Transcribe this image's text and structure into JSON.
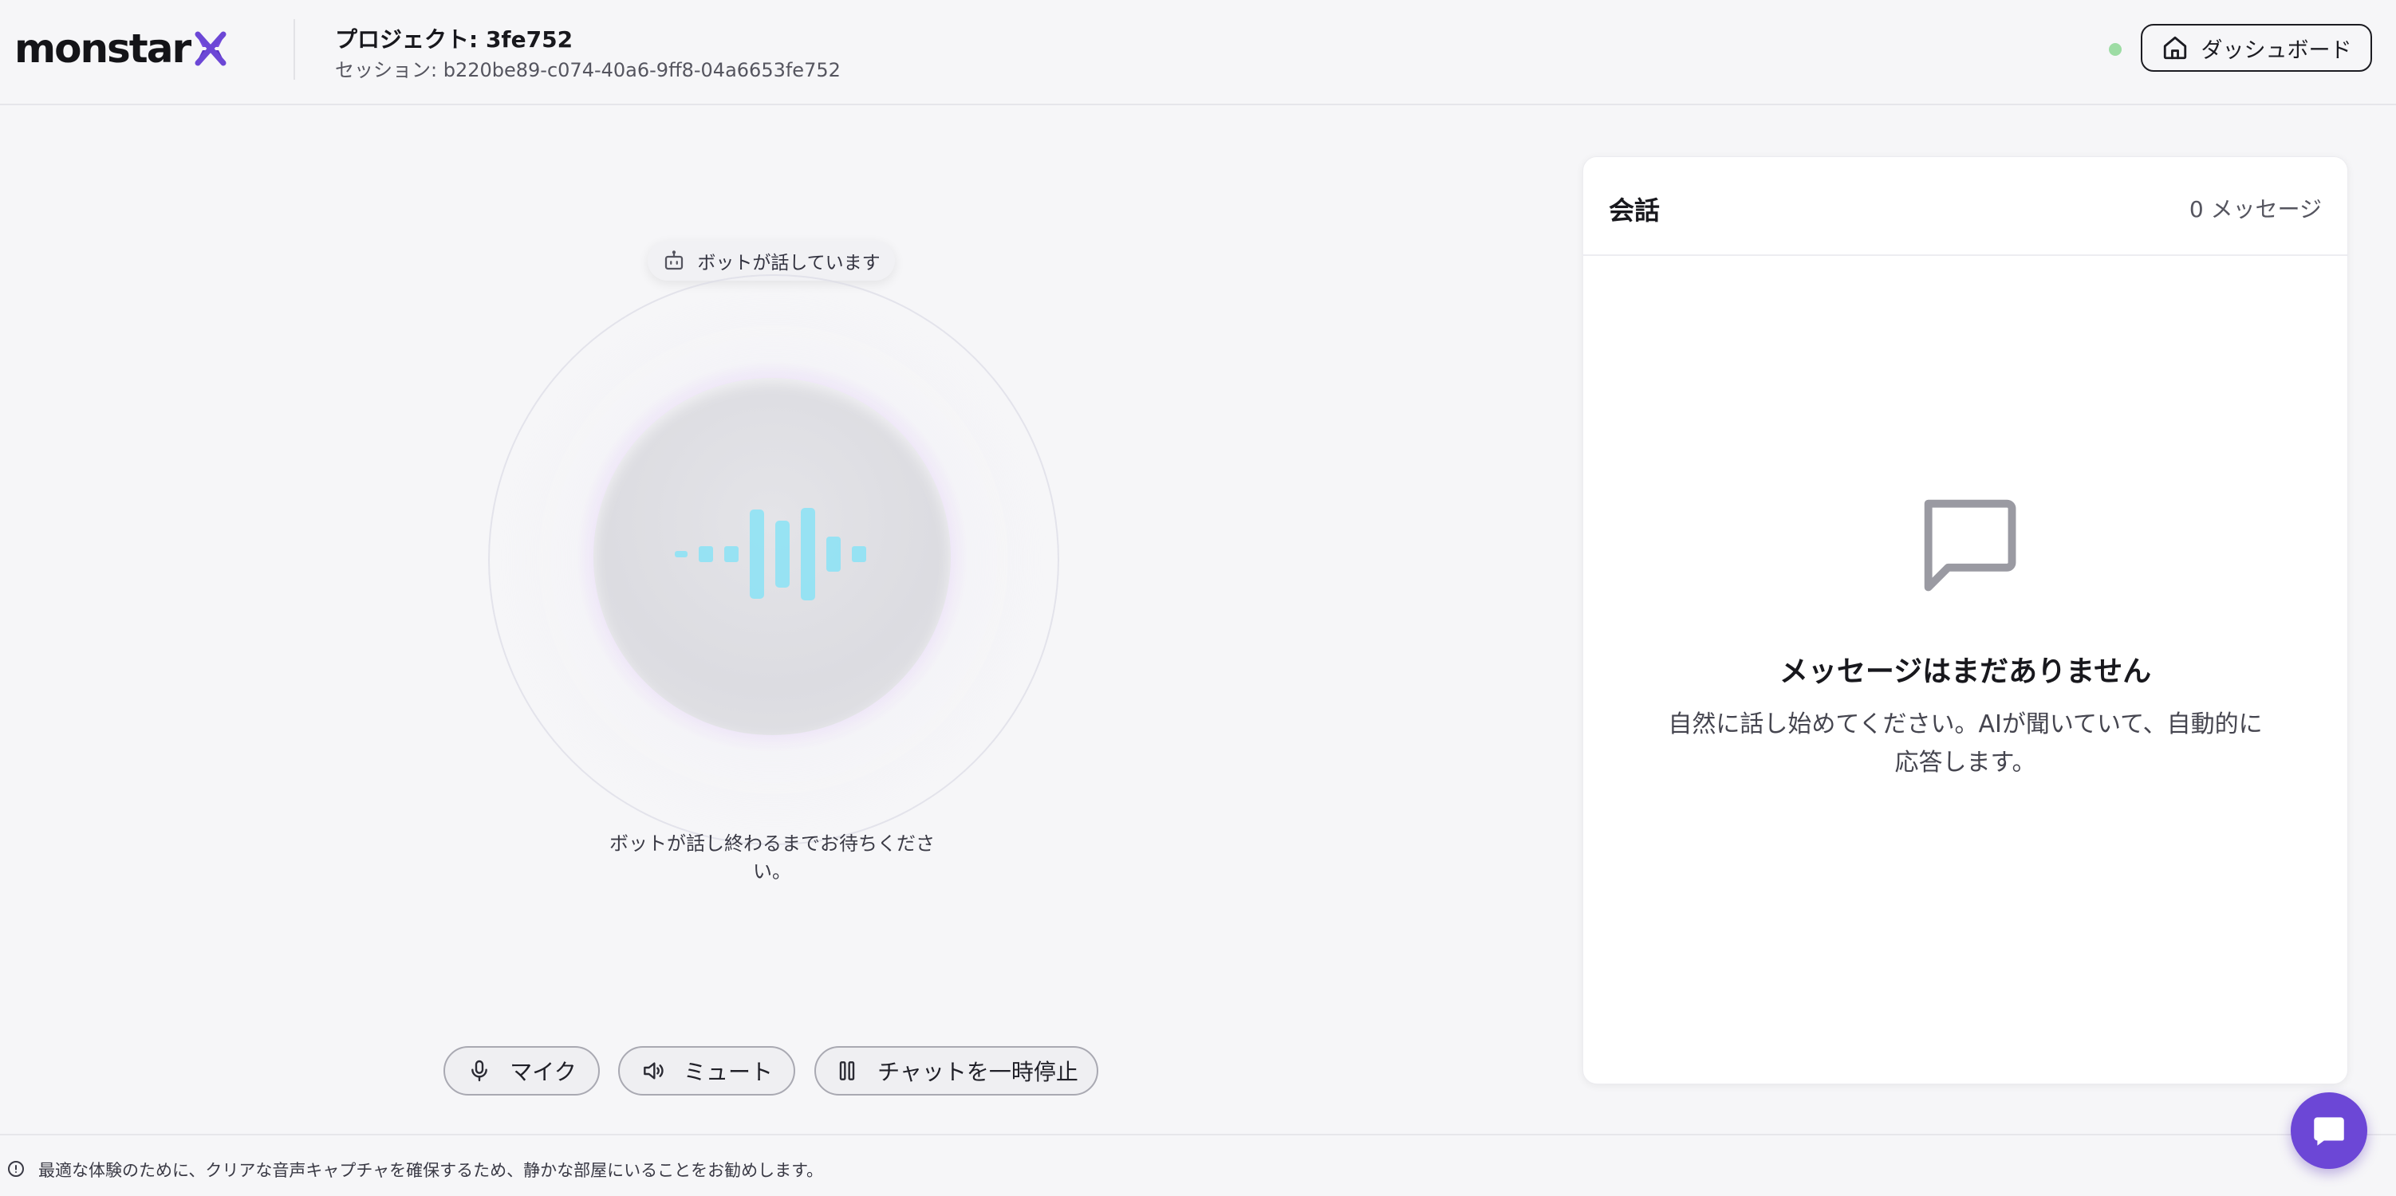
{
  "header": {
    "logo_text": "monstar",
    "project_title": "プロジェクト: 3fe752",
    "session_id": "セッション: b220be89-c074-40a6-9ff8-04a6653fe752",
    "dashboard_label": "ダッシュボード",
    "status_color": "#9ddca4"
  },
  "voice": {
    "status_pill": "ボットが話しています",
    "wait_message": "ボットが話し終わるまでお待ちください。",
    "orb_glow_color": "#c18cf5",
    "wave_color": "#8fe3f5"
  },
  "controls": {
    "mic_label": "マイク",
    "mute_label": "ミュート",
    "pause_label": "チャットを一時停止"
  },
  "conversation": {
    "title": "会話",
    "count": "0 メッセージ",
    "empty_title": "メッセージはまだありません",
    "empty_desc": "自然に話し始めてください。AIが聞いていて、自動的に応答します。"
  },
  "footer": {
    "notice": "最適な体験のために、クリアな音声キャプチャを確保するため、静かな部屋にいることをお勧めします。"
  },
  "colors": {
    "accent": "#6c47d6",
    "background": "#f6f6f8"
  }
}
